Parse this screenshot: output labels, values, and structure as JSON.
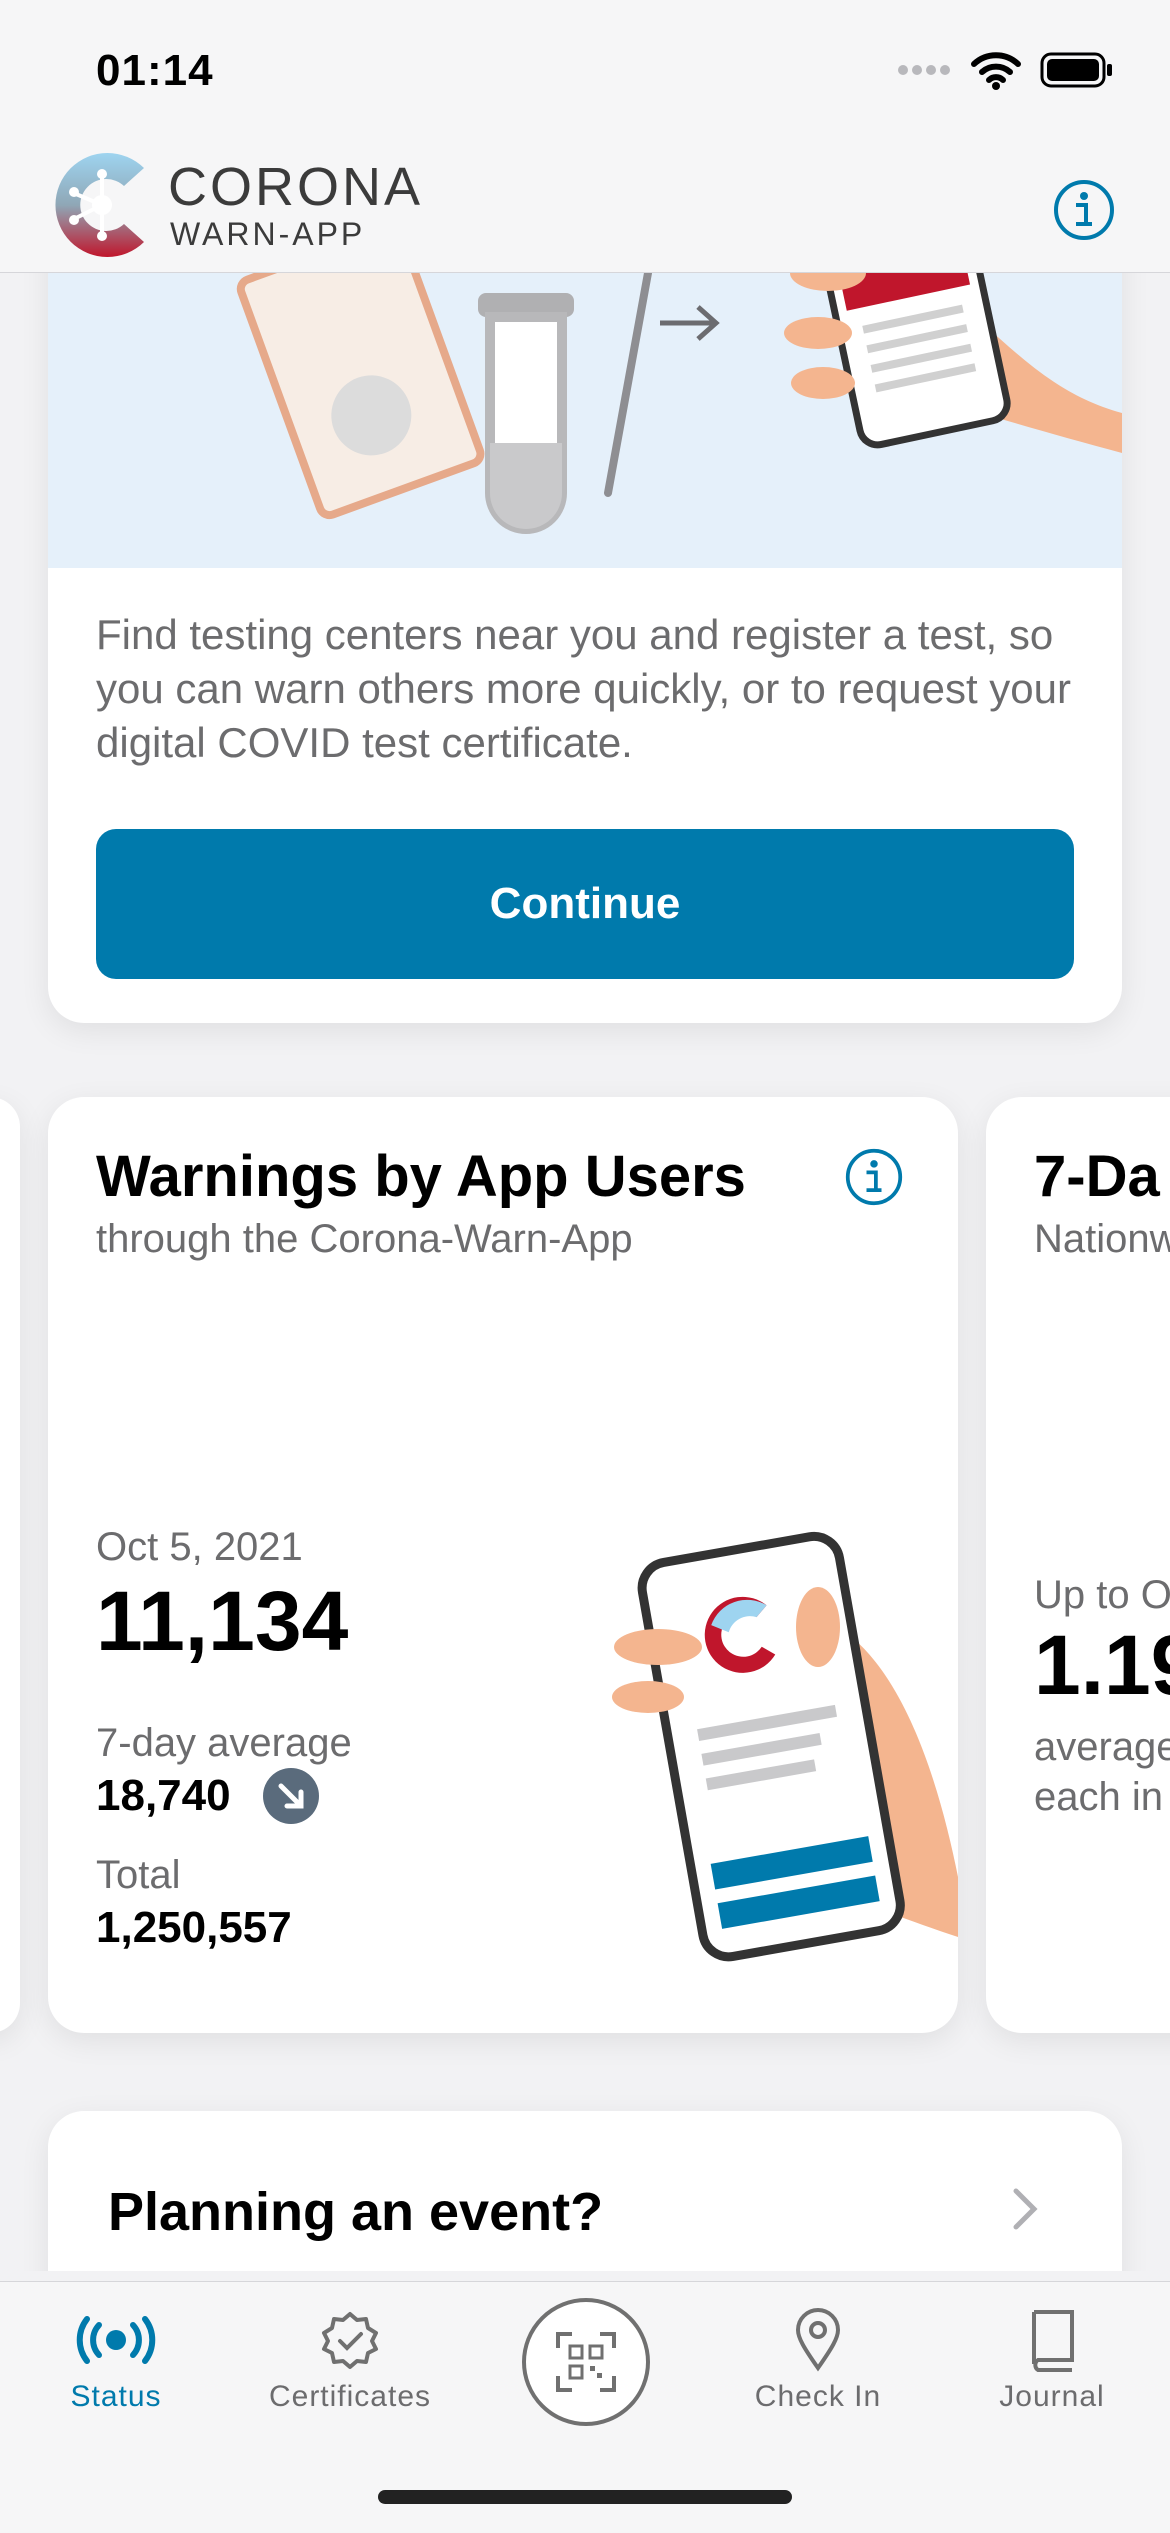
{
  "status_bar": {
    "time": "01:14"
  },
  "header": {
    "brand_title": "CORONA",
    "brand_subtitle": "WARN-APP"
  },
  "test_card": {
    "description": "Find testing centers near you and register a test, so you can warn others more quickly, or to request your digital COVID test certificate.",
    "button_label": "Continue"
  },
  "stats_card": {
    "title": "Warnings by App Users",
    "subtitle": "through the Corona-Warn-App",
    "date": "Oct 5, 2021",
    "primary_value": "11,134",
    "avg_label": "7-day average",
    "avg_value": "18,740",
    "total_label": "Total",
    "total_value": "1,250,557"
  },
  "next_card_peek": {
    "title": "7-Da",
    "subtitle": "Nationw",
    "upto": "Up to O",
    "value": "1.19",
    "line1": "average",
    "line2": "each in"
  },
  "event_card": {
    "title": "Planning an event?"
  },
  "tabbar": {
    "items": [
      {
        "label": "Status",
        "icon": "status-icon",
        "active": true
      },
      {
        "label": "Certificates",
        "icon": "certificate-icon",
        "active": false
      },
      {
        "label": "",
        "icon": "qr-scan-icon",
        "active": false
      },
      {
        "label": "Check In",
        "icon": "location-pin-icon",
        "active": false
      },
      {
        "label": "Journal",
        "icon": "journal-icon",
        "active": false
      }
    ]
  },
  "colors": {
    "accent": "#007aac",
    "brand_red": "#c0162c",
    "illustration_bg": "#e5f0fa"
  }
}
